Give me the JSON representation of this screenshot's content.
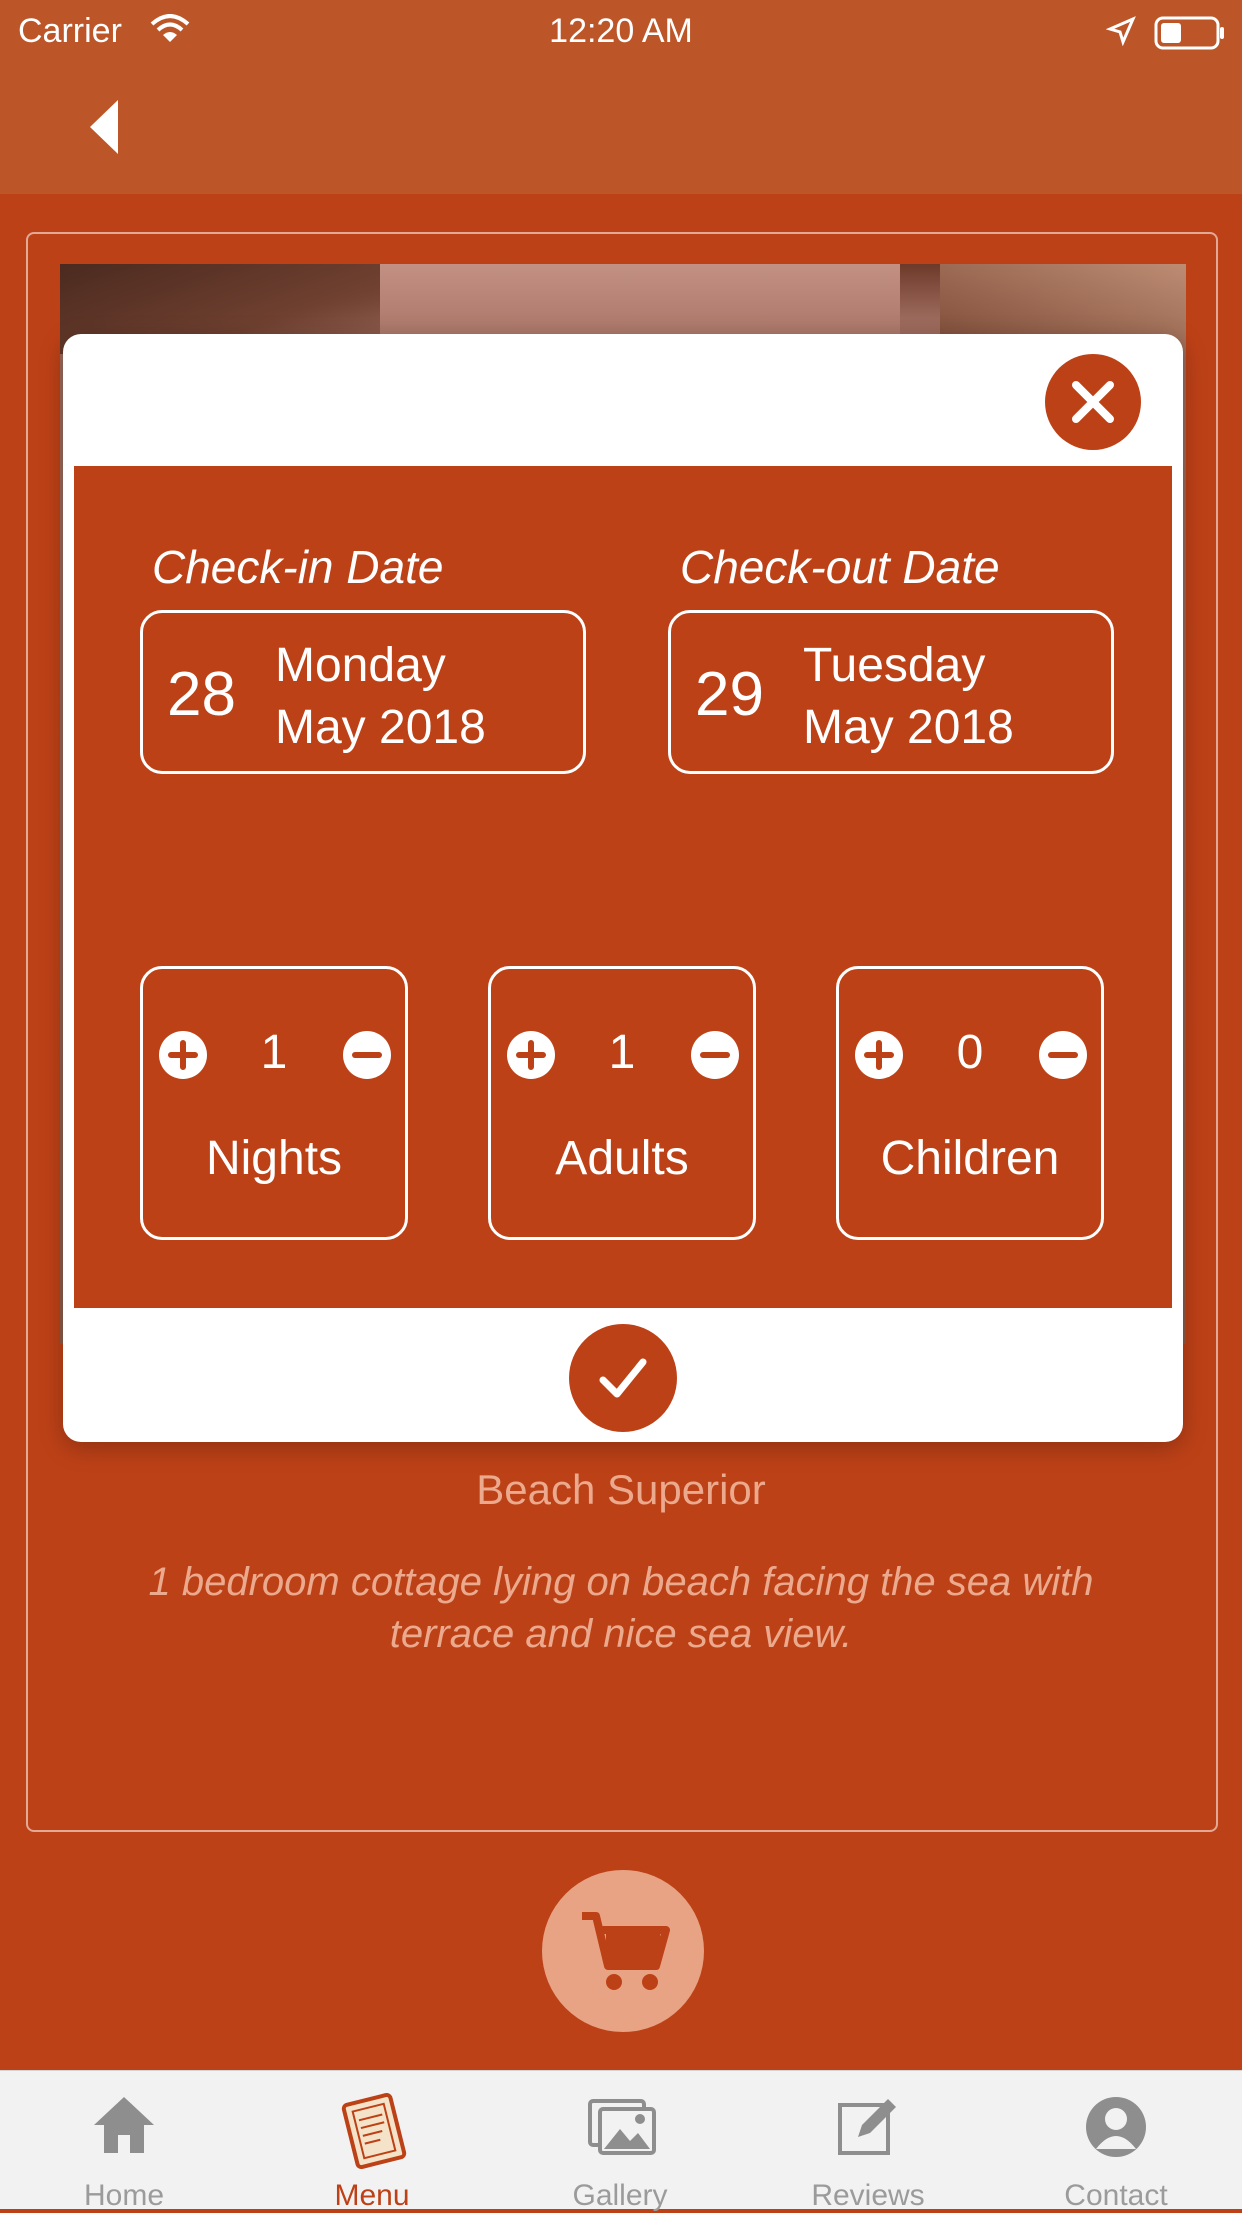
{
  "colors": {
    "accent": "#bd4117",
    "header": "#bc5629",
    "muted_text": "#eba98d",
    "tab_bar": "#f2f2f2"
  },
  "status_bar": {
    "carrier": "Carrier",
    "time": "12:20 AM"
  },
  "room": {
    "title": "Beach Superior",
    "description": "1 bedroom cottage lying on beach facing the sea with terrace and nice sea view."
  },
  "booking_modal": {
    "check_in": {
      "label": "Check-in Date",
      "day": "28",
      "weekday": "Monday",
      "month_year": "May 2018"
    },
    "check_out": {
      "label": "Check-out Date",
      "day": "29",
      "weekday": "Tuesday",
      "month_year": "May 2018"
    },
    "steppers": [
      {
        "label": "Nights",
        "value": "1"
      },
      {
        "label": "Adults",
        "value": "1"
      },
      {
        "label": "Children",
        "value": "0"
      }
    ]
  },
  "tabs": [
    {
      "label": "Home",
      "icon": "home-icon"
    },
    {
      "label": "Menu",
      "icon": "menu-book-icon",
      "active": true
    },
    {
      "label": "Gallery",
      "icon": "gallery-icon"
    },
    {
      "label": "Reviews",
      "icon": "edit-icon"
    },
    {
      "label": "Contact",
      "icon": "person-icon"
    }
  ]
}
